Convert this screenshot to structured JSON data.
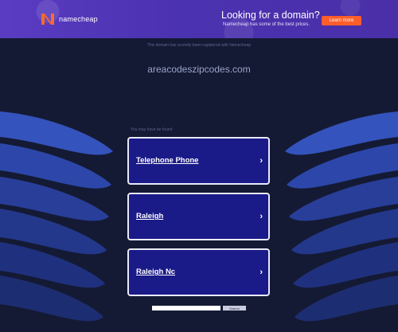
{
  "ad": {
    "brand": "namecheap",
    "headline": "Looking for a domain?",
    "subtext": "Namecheap has some of the best prices.",
    "cta_label": "Learn more",
    "colors": {
      "background": "#4b32b0",
      "cta": "#ff5e2b",
      "brand_mark": "#ff6a2b"
    }
  },
  "page": {
    "disclaimer": "This domain has recently been registered with Namecheap",
    "domain": "areacodeszipcodes.com",
    "related_heading": "You may have be found",
    "background_color": "#141a34"
  },
  "links": [
    {
      "label": "Telephone Phone",
      "icon": "chevron-right-icon"
    },
    {
      "label": "Raleigh",
      "icon": "chevron-right-icon"
    },
    {
      "label": "Raleigh Nc",
      "icon": "chevron-right-icon"
    }
  ],
  "search": {
    "placeholder": "",
    "button_label": "Search"
  }
}
